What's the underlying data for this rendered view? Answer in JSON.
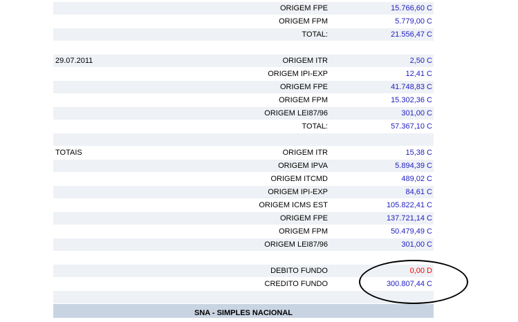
{
  "rows": [
    {
      "date": "",
      "label": "ORIGEM FPE",
      "value": "15.766,60 C",
      "kind": "c"
    },
    {
      "date": "",
      "label": "ORIGEM FPM",
      "value": "5.779,00 C",
      "kind": "c"
    },
    {
      "date": "",
      "label": "TOTAL:",
      "value": "21.556,47 C",
      "kind": "c"
    },
    {
      "date": "",
      "label": "",
      "value": "",
      "kind": "c"
    },
    {
      "date": "29.07.2011",
      "label": "ORIGEM ITR",
      "value": "2,50 C",
      "kind": "c"
    },
    {
      "date": "",
      "label": "ORIGEM IPI-EXP",
      "value": "12,41 C",
      "kind": "c"
    },
    {
      "date": "",
      "label": "ORIGEM FPE",
      "value": "41.748,83 C",
      "kind": "c"
    },
    {
      "date": "",
      "label": "ORIGEM FPM",
      "value": "15.302,36 C",
      "kind": "c"
    },
    {
      "date": "",
      "label": "ORIGEM LEI87/96",
      "value": "301,00 C",
      "kind": "c"
    },
    {
      "date": "",
      "label": "TOTAL:",
      "value": "57.367,10 C",
      "kind": "c"
    },
    {
      "date": "",
      "label": "",
      "value": "",
      "kind": "c"
    },
    {
      "date": "TOTAIS",
      "label": "ORIGEM ITR",
      "value": "15,38 C",
      "kind": "c"
    },
    {
      "date": "",
      "label": "ORIGEM IPVA",
      "value": "5.894,39 C",
      "kind": "c"
    },
    {
      "date": "",
      "label": "ORIGEM ITCMD",
      "value": "489,02 C",
      "kind": "c"
    },
    {
      "date": "",
      "label": "ORIGEM IPI-EXP",
      "value": "84,61 C",
      "kind": "c"
    },
    {
      "date": "",
      "label": "ORIGEM ICMS EST",
      "value": "105.822,41 C",
      "kind": "c"
    },
    {
      "date": "",
      "label": "ORIGEM FPE",
      "value": "137.721,14 C",
      "kind": "c"
    },
    {
      "date": "",
      "label": "ORIGEM FPM",
      "value": "50.479,49 C",
      "kind": "c"
    },
    {
      "date": "",
      "label": "ORIGEM LEI87/96",
      "value": "301,00 C",
      "kind": "c"
    },
    {
      "date": "",
      "label": "",
      "value": "",
      "kind": "c"
    },
    {
      "date": "",
      "label": "DEBITO FUNDO",
      "value": "0,00 D",
      "kind": "d"
    },
    {
      "date": "",
      "label": "CREDITO FUNDO",
      "value": "300.807,44 C",
      "kind": "c"
    },
    {
      "date": "",
      "label": "",
      "value": "",
      "kind": "c"
    }
  ],
  "section_header": "SNA - SIMPLES NACIONAL",
  "colors": {
    "credit": "#2020c0",
    "debit": "#ff0000",
    "row_alt": "#eef1f5",
    "header_bg": "#c9d4e2"
  }
}
